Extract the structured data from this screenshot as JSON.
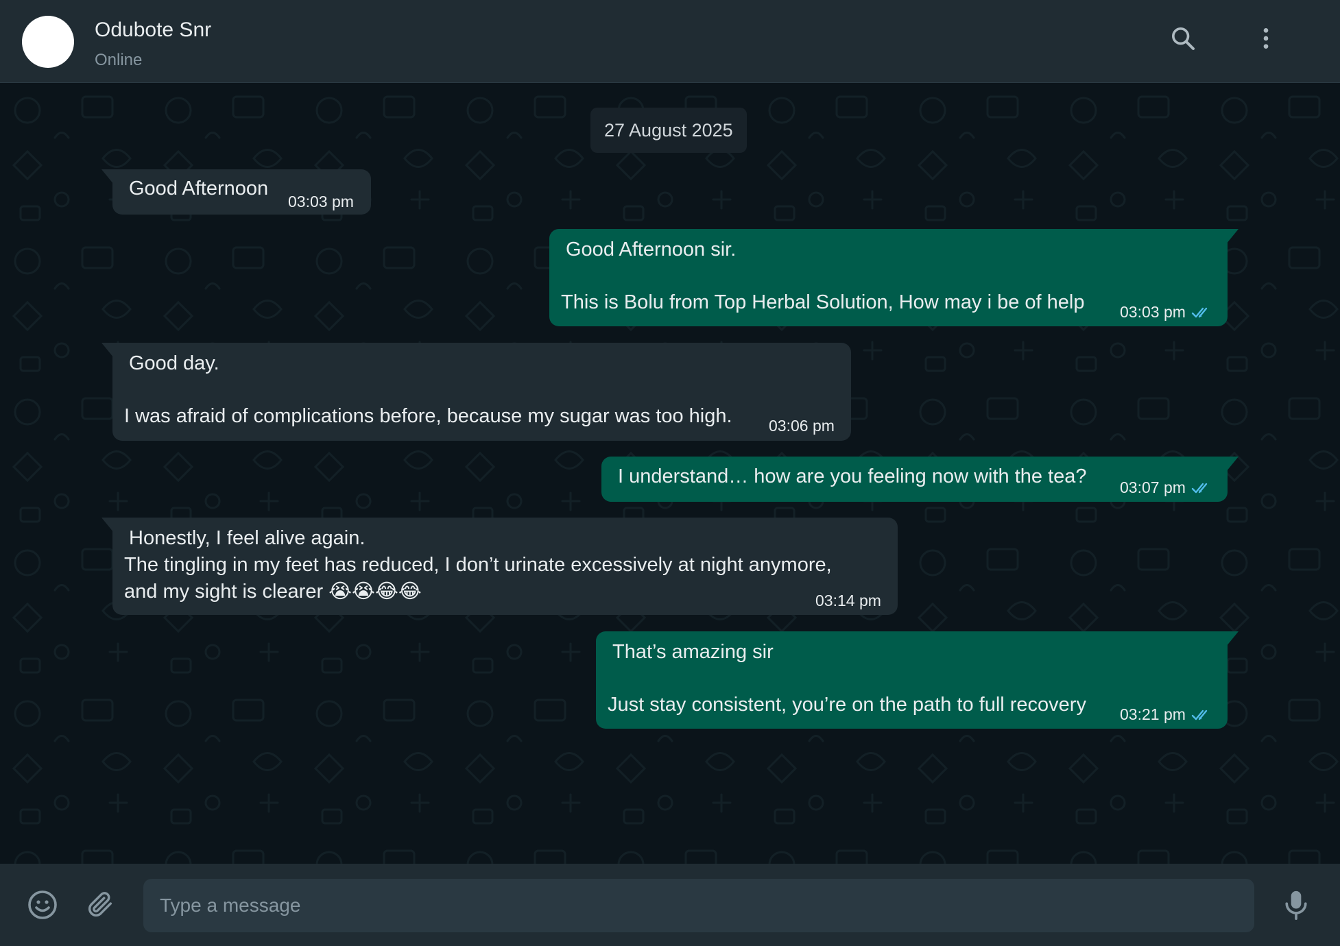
{
  "header": {
    "contact_name": "Odubote Snr",
    "status": "Online",
    "search_icon": "search-icon",
    "menu_icon": "more-vertical-icon"
  },
  "chat": {
    "date_separator": "27 August 2025",
    "messages": [
      {
        "direction": "incoming",
        "lines": [
          "Good Afternoon"
        ],
        "time": "03:03 pm"
      },
      {
        "direction": "outgoing",
        "lines": [
          "Good Afternoon sir.",
          "",
          "This is Bolu from Top Herbal Solution, How may i be of help"
        ],
        "time": "03:03 pm",
        "read_receipt": "double-check-icon"
      },
      {
        "direction": "incoming",
        "lines": [
          "Good day.",
          "",
          "I was afraid of complications before, because my sugar was too high."
        ],
        "time": "03:06 pm"
      },
      {
        "direction": "outgoing",
        "lines": [
          "I understand… how are you feeling now with the tea?"
        ],
        "time": "03:07 pm",
        "read_receipt": "double-check-icon"
      },
      {
        "direction": "incoming",
        "lines": [
          "Honestly, I feel alive again.",
          "The tingling in my feet has reduced, I don’t urinate excessively at night anymore,",
          "and my sight is clearer 😭😭😂😂"
        ],
        "time": "03:14 pm"
      },
      {
        "direction": "outgoing",
        "lines": [
          "That’s amazing sir",
          "",
          "Just stay consistent, you’re on the path to full recovery"
        ],
        "time": "03:21 pm",
        "read_receipt": "double-check-icon"
      }
    ]
  },
  "footer": {
    "placeholder": "Type a message",
    "emoji_icon": "emoji-icon",
    "attach_icon": "paperclip-icon",
    "mic_icon": "microphone-icon"
  },
  "colors": {
    "header_bg": "#202c33",
    "chat_bg": "#0b141a",
    "incoming_bubble": "#202c33",
    "outgoing_bubble": "#005c4b",
    "read_tick": "#53bdeb",
    "primary_text": "#e9edef",
    "secondary_text": "#8696a0"
  }
}
